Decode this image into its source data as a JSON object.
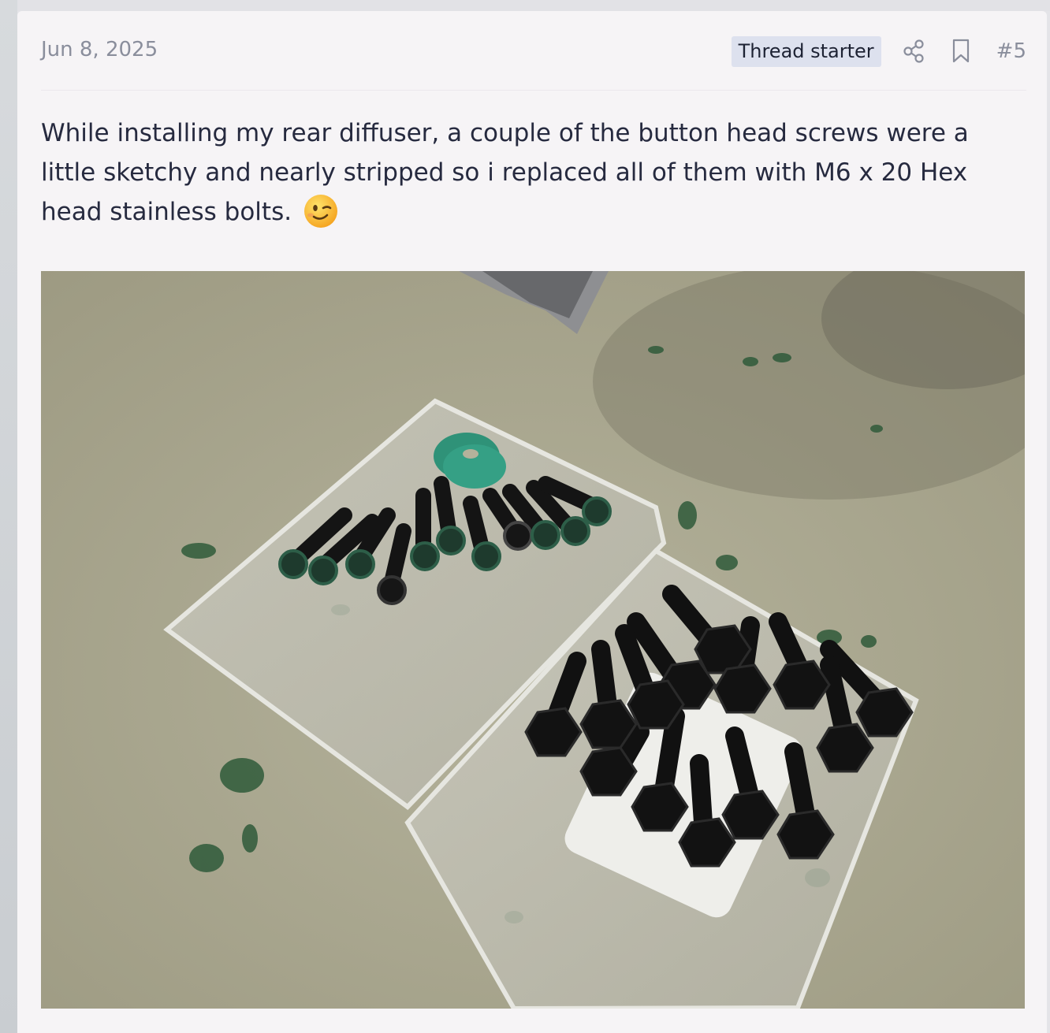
{
  "post": {
    "date": "Jun 8, 2025",
    "badge": "Thread starter",
    "post_number": "#5",
    "message": "While installing my rear diffuser, a couple of the button head screws were a little sketchy and nearly stripped so i replaced all of them with M6 x 20 Hex head stainless bolts.",
    "emoji": "winking-face-icon"
  },
  "icons": {
    "share": "share-icon",
    "bookmark": "bookmark-icon"
  },
  "colors": {
    "page_bg": "#f6f4f6",
    "badge_bg": "#dde1ee",
    "muted_text": "#8a8e9c",
    "body_text": "#262a3f"
  }
}
